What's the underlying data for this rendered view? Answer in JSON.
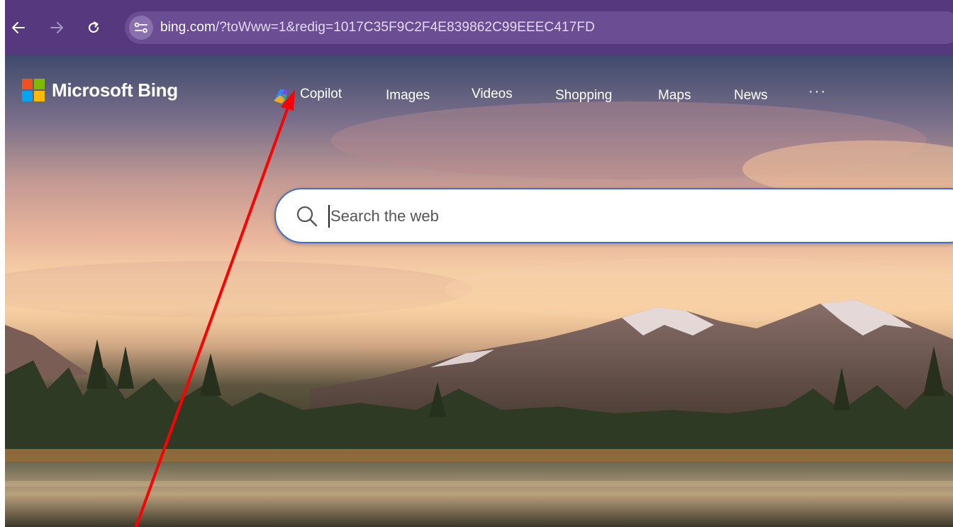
{
  "browser": {
    "url_host": "bing.com",
    "url_path": "/?toWww=1&redig=1017C35F9C2F4E839862C99EEEC417FD",
    "icons": {
      "back": "back-arrow-icon",
      "forward": "forward-arrow-icon",
      "reload": "reload-icon",
      "site_info": "site-info-icon"
    }
  },
  "header": {
    "logo_text": "Microsoft Bing",
    "nav": [
      {
        "label": "Copilot"
      },
      {
        "label": "Images"
      },
      {
        "label": "Videos"
      },
      {
        "label": "Shopping"
      },
      {
        "label": "Maps"
      },
      {
        "label": "News"
      }
    ],
    "more_label": "···"
  },
  "search": {
    "placeholder": "Search the web",
    "value": ""
  },
  "annotation": {
    "color": "#ff0000",
    "shape": "red-arrow-pointing-to-copilot"
  },
  "colors": {
    "toolbar": "#56387f",
    "search_border": "#3b6fcf",
    "ms_red": "#f25022",
    "ms_green": "#7fba00",
    "ms_blue": "#00a4ef",
    "ms_yellow": "#ffb900"
  }
}
